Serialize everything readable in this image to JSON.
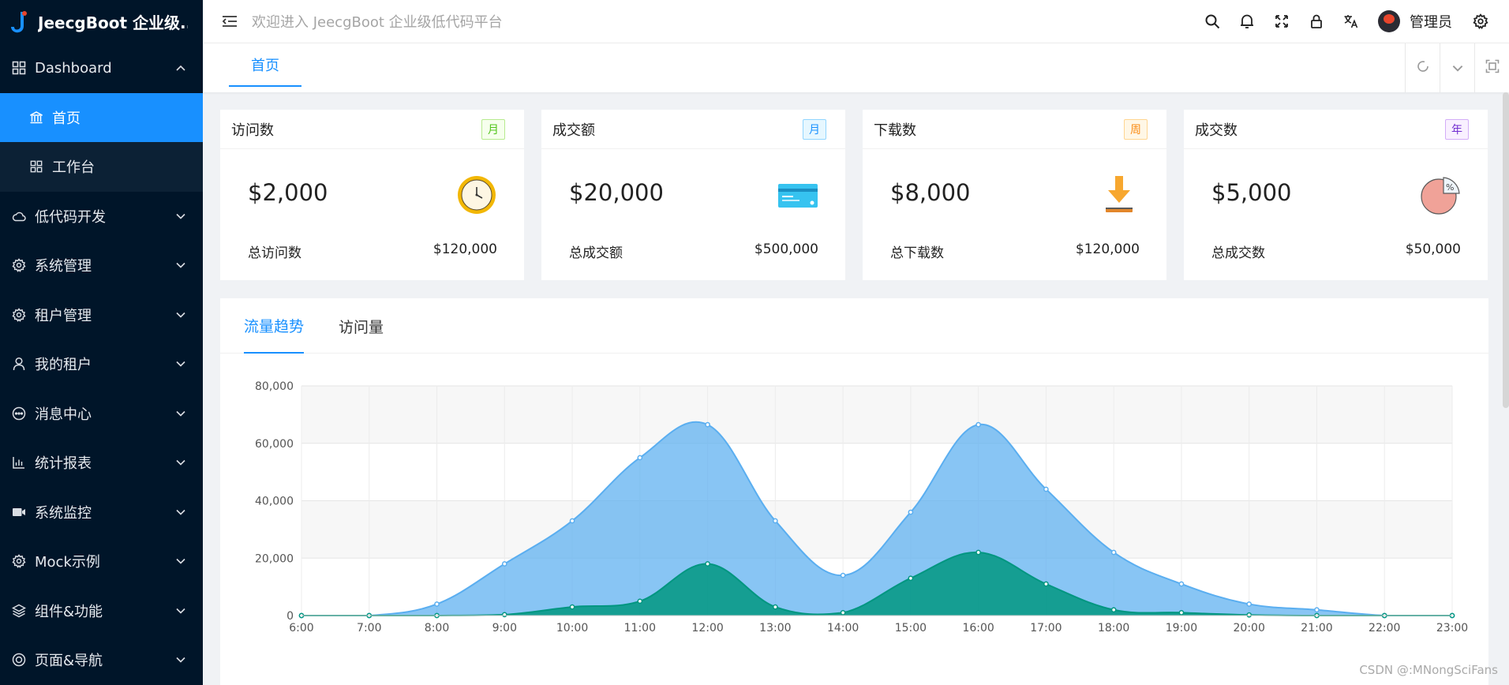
{
  "app": {
    "title": "JeecgBoot 企业级..."
  },
  "sidebar": {
    "dashboard": {
      "label": "Dashboard",
      "icon": "grid-icon"
    },
    "submenu": [
      {
        "label": "首页",
        "icon": "bank-icon",
        "active": true
      },
      {
        "label": "工作台",
        "icon": "grid-icon",
        "active": false
      }
    ],
    "items": [
      {
        "label": "低代码开发",
        "icon": "cloud-icon"
      },
      {
        "label": "系统管理",
        "icon": "gear-icon"
      },
      {
        "label": "租户管理",
        "icon": "gear-icon"
      },
      {
        "label": "我的租户",
        "icon": "user-icon"
      },
      {
        "label": "消息中心",
        "icon": "message-icon"
      },
      {
        "label": "统计报表",
        "icon": "bar-chart-icon"
      },
      {
        "label": "系统监控",
        "icon": "video-icon"
      },
      {
        "label": "Mock示例",
        "icon": "gear-icon"
      },
      {
        "label": "组件&功能",
        "icon": "layers-icon"
      },
      {
        "label": "页面&导航",
        "icon": "compass-icon"
      }
    ]
  },
  "header": {
    "welcome": "欢迎进入 JeecgBoot 企业级低代码平台",
    "user_name": "管理员"
  },
  "tabs": {
    "home": "首页"
  },
  "cards": [
    {
      "title": "访问数",
      "tag": "月",
      "tag_color": "#52c41a",
      "value": "$2,000",
      "foot_label": "总访问数",
      "foot_value": "$120,000",
      "icon": "clock-icon"
    },
    {
      "title": "成交额",
      "tag": "月",
      "tag_color": "#1890ff",
      "value": "$20,000",
      "foot_label": "总成交额",
      "foot_value": "$500,000",
      "icon": "credit-card-icon"
    },
    {
      "title": "下载数",
      "tag": "周",
      "tag_color": "#fa8c16",
      "value": "$8,000",
      "foot_label": "总下载数",
      "foot_value": "$120,000",
      "icon": "download-icon"
    },
    {
      "title": "成交数",
      "tag": "年",
      "tag_color": "#722ed1",
      "value": "$5,000",
      "foot_label": "总成交数",
      "foot_value": "$50,000",
      "icon": "pie-percent-icon"
    }
  ],
  "chart_tabs": [
    {
      "label": "流量趋势",
      "active": true
    },
    {
      "label": "访问量",
      "active": false
    }
  ],
  "chart_data": {
    "type": "area",
    "x": [
      "6:00",
      "7:00",
      "8:00",
      "9:00",
      "10:00",
      "11:00",
      "12:00",
      "13:00",
      "14:00",
      "15:00",
      "16:00",
      "17:00",
      "18:00",
      "19:00",
      "20:00",
      "21:00",
      "22:00",
      "23:00"
    ],
    "series": [
      {
        "values": [
          0,
          0,
          4000,
          18000,
          33000,
          55000,
          66500,
          33000,
          14000,
          36000,
          66500,
          44000,
          22000,
          11000,
          4000,
          2000,
          0,
          0
        ],
        "color": "#5aaef0"
      },
      {
        "values": [
          0,
          0,
          0,
          300,
          3000,
          5000,
          18000,
          3000,
          1000,
          13000,
          22000,
          11000,
          2000,
          1000,
          200,
          0,
          0,
          0
        ],
        "color": "#019680"
      }
    ],
    "ylim": [
      0,
      80000
    ],
    "yticks": [
      0,
      20000,
      40000,
      60000,
      80000
    ],
    "ytick_labels": [
      "0",
      "20,000",
      "40,000",
      "60,000",
      "80,000"
    ],
    "grid": true
  },
  "watermark": "CSDN @:MNongSciFans"
}
